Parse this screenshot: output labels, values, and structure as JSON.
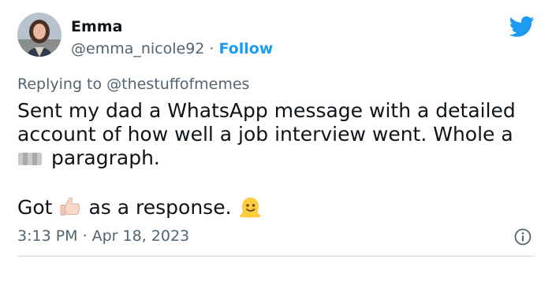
{
  "tweet": {
    "author": {
      "name": "Emma",
      "handle": "@emma_nicole92",
      "separator": "·",
      "follow_label": "Follow"
    },
    "reply": {
      "prefix": "Replying to",
      "mention": "@thestuffofmemes"
    },
    "text": {
      "part1": "Sent my dad a WhatsApp message with a detailed account of how well a job interview went. Whole a",
      "part2": " paragraph.",
      "line2_start": "Got",
      "line2_mid": "as a response."
    },
    "meta": {
      "time": "3:13 PM",
      "separator": "·",
      "date": "Apr 18, 2023"
    },
    "icons": {
      "brand": "twitter-bird-icon",
      "thumb": "thumbs-up-emoji",
      "melting": "melting-face-emoji",
      "info": "info-icon"
    },
    "colors": {
      "accent": "#1d9bf0",
      "text": "#0f1419",
      "muted": "#536471",
      "divider": "#cfd9de"
    }
  }
}
